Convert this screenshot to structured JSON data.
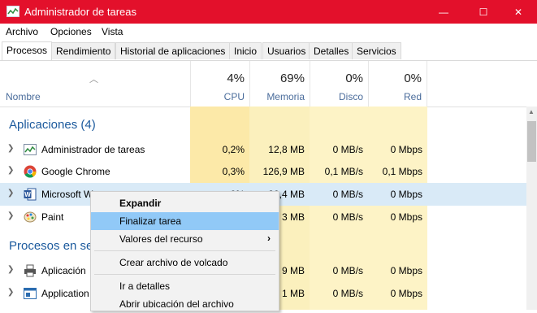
{
  "window": {
    "title": "Administrador de tareas",
    "buttons": {
      "minimize": "—",
      "maximize": "☐",
      "close": "✕"
    }
  },
  "menu": [
    "Archivo",
    "Opciones",
    "Vista"
  ],
  "tabs": [
    "Procesos",
    "Rendimiento",
    "Historial de aplicaciones",
    "Inicio",
    "Usuarios",
    "Detalles",
    "Servicios"
  ],
  "columns": {
    "name": "Nombre",
    "cpu": {
      "pct": "4%",
      "label": "CPU"
    },
    "memory": {
      "pct": "69%",
      "label": "Memoria"
    },
    "disk": {
      "pct": "0%",
      "label": "Disco"
    },
    "network": {
      "pct": "0%",
      "label": "Red"
    }
  },
  "sections": {
    "apps": "Aplicaciones (4)",
    "background": "Procesos en se"
  },
  "rows": [
    {
      "name": "Administrador de tareas",
      "cpu": "0,2%",
      "mem": "12,8 MB",
      "disk": "0 MB/s",
      "net": "0 Mbps",
      "icon": "task-manager-icon"
    },
    {
      "name": "Google Chrome",
      "cpu": "0,3%",
      "mem": "126,9 MB",
      "disk": "0,1 MB/s",
      "net": "0,1 Mbps",
      "icon": "chrome-icon"
    },
    {
      "name": "Microsoft W",
      "cpu": "0%",
      "mem": "30,4 MB",
      "disk": "0 MB/s",
      "net": "0 Mbps",
      "icon": "word-icon"
    },
    {
      "name": "Paint",
      "cpu": "",
      "mem": "3 MB",
      "disk": "0 MB/s",
      "net": "0 Mbps",
      "icon": "paint-icon"
    },
    {
      "name": "Aplicación",
      "cpu": "",
      "mem": "9 MB",
      "disk": "0 MB/s",
      "net": "0 Mbps",
      "icon": "printer-icon"
    },
    {
      "name": "Application",
      "cpu": "",
      "mem": "1 MB",
      "disk": "0 MB/s",
      "net": "0 Mbps",
      "icon": "app-window-icon"
    }
  ],
  "context_menu": {
    "items": [
      "Expandir",
      "Finalizar tarea",
      "Valores del recurso",
      "Crear archivo de volcado",
      "Ir a detalles",
      "Abrir ubicación del archivo"
    ],
    "submenu_arrow": "›"
  },
  "colors": {
    "titlebar": "#e3102b",
    "highlight": "#91c9f7",
    "column_tint": "#fdf3c6",
    "section_text": "#1c5a9d"
  }
}
